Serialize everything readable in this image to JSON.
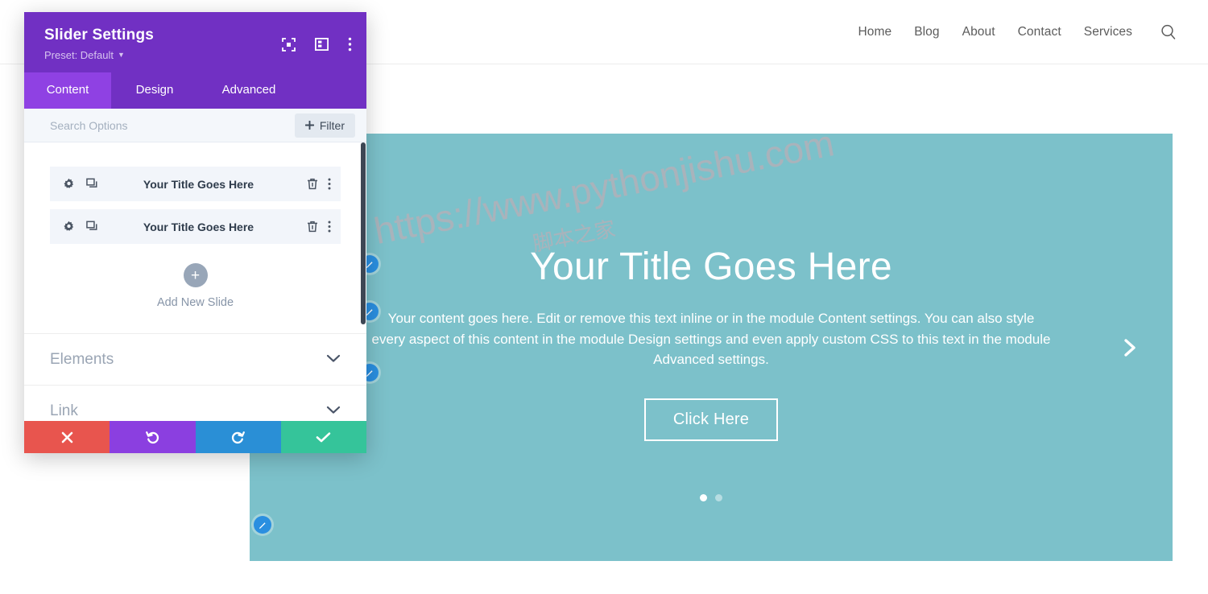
{
  "site_header": {
    "nav": [
      {
        "label": "Home"
      },
      {
        "label": "Blog"
      },
      {
        "label": "About"
      },
      {
        "label": "Contact"
      },
      {
        "label": "Services"
      }
    ],
    "search_icon": "search-icon"
  },
  "slider": {
    "background_color": "#7cc1ca",
    "title": "Your Title Goes Here",
    "body": "Your content goes here. Edit or remove this text inline or in the module Content settings. You can also style every aspect of this content in the module Design settings and even apply custom CSS to this text in the module Advanced settings.",
    "cta_label": "Click Here",
    "next_arrow_icon": "chevron-right-icon",
    "dots": [
      {
        "active": true
      },
      {
        "active": false
      }
    ],
    "watermark": "https://www.pythonjishu.com",
    "watermark_sub": "脚本之家"
  },
  "edit_badges": [
    {
      "icon": "pencil-icon"
    },
    {
      "icon": "pencil-icon"
    },
    {
      "icon": "pencil-icon"
    },
    {
      "icon": "pencil-icon"
    }
  ],
  "modal": {
    "title": "Slider Settings",
    "preset_label": "Preset: Default",
    "header_color": "#7130c3",
    "active_tab_color": "#8f41e3",
    "header_icons": [
      {
        "name": "focus-target-icon"
      },
      {
        "name": "layout-panel-icon"
      },
      {
        "name": "kebab-menu-icon"
      }
    ],
    "tabs": [
      {
        "label": "Content",
        "active": true
      },
      {
        "label": "Design",
        "active": false
      },
      {
        "label": "Advanced",
        "active": false
      }
    ],
    "search": {
      "value": "",
      "placeholder": "Search Options",
      "filter_label": "Filter",
      "filter_icon": "plus-icon"
    },
    "slides": [
      {
        "title": "Your Title Goes Here",
        "settings_icon": "gear-icon",
        "duplicate_icon": "duplicate-icon",
        "delete_icon": "trash-icon",
        "more_icon": "kebab-menu-icon"
      },
      {
        "title": "Your Title Goes Here",
        "settings_icon": "gear-icon",
        "duplicate_icon": "duplicate-icon",
        "delete_icon": "trash-icon",
        "more_icon": "kebab-menu-icon"
      }
    ],
    "add_slide": {
      "label": "Add New Slide",
      "icon": "plus-icon"
    },
    "sections": [
      {
        "title": "Elements",
        "chevron": "chevron-down-icon"
      },
      {
        "title": "Link",
        "chevron": "chevron-down-icon"
      }
    ],
    "footer_buttons": [
      {
        "name": "cancel-button",
        "icon": "close-x-icon",
        "color": "#e8554e"
      },
      {
        "name": "undo-button",
        "icon": "undo-icon",
        "color": "#8b3fe0"
      },
      {
        "name": "redo-button",
        "icon": "redo-icon",
        "color": "#2a8fd6"
      },
      {
        "name": "save-button",
        "icon": "checkmark-icon",
        "color": "#35c49a"
      }
    ]
  }
}
